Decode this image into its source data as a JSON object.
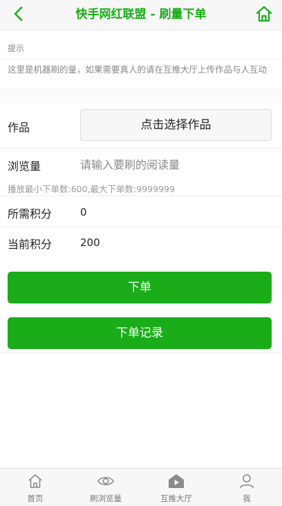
{
  "header": {
    "title": "快手网红联盟 - 刷量下单",
    "back_icon": "chevron-left-icon",
    "home_icon": "home-icon",
    "accent_color": "#1aad19"
  },
  "notice": {
    "label": "提示",
    "text": "这里是机器刷的量，如果需要真人的请在互推大厅上传作品与人互动"
  },
  "form": {
    "works_label": "作品",
    "choose_button": "点击选择作品",
    "views_label": "浏览量",
    "views_placeholder": "请输入要刷的阅读量",
    "range_tip": "播放最小下单数:600,最大下单数:9999999",
    "need_points_label": "所需积分",
    "need_points_value": "0",
    "current_points_label": "当前积分",
    "current_points_value": "200"
  },
  "actions": {
    "order_button": "下单",
    "records_button": "下单记录"
  },
  "tabbar": {
    "items": [
      {
        "label": "首页",
        "icon": "home-icon"
      },
      {
        "label": "刷浏览量",
        "icon": "eye-icon"
      },
      {
        "label": "互推大厅",
        "icon": "play-house-icon"
      },
      {
        "label": "我",
        "icon": "user-icon"
      }
    ]
  }
}
